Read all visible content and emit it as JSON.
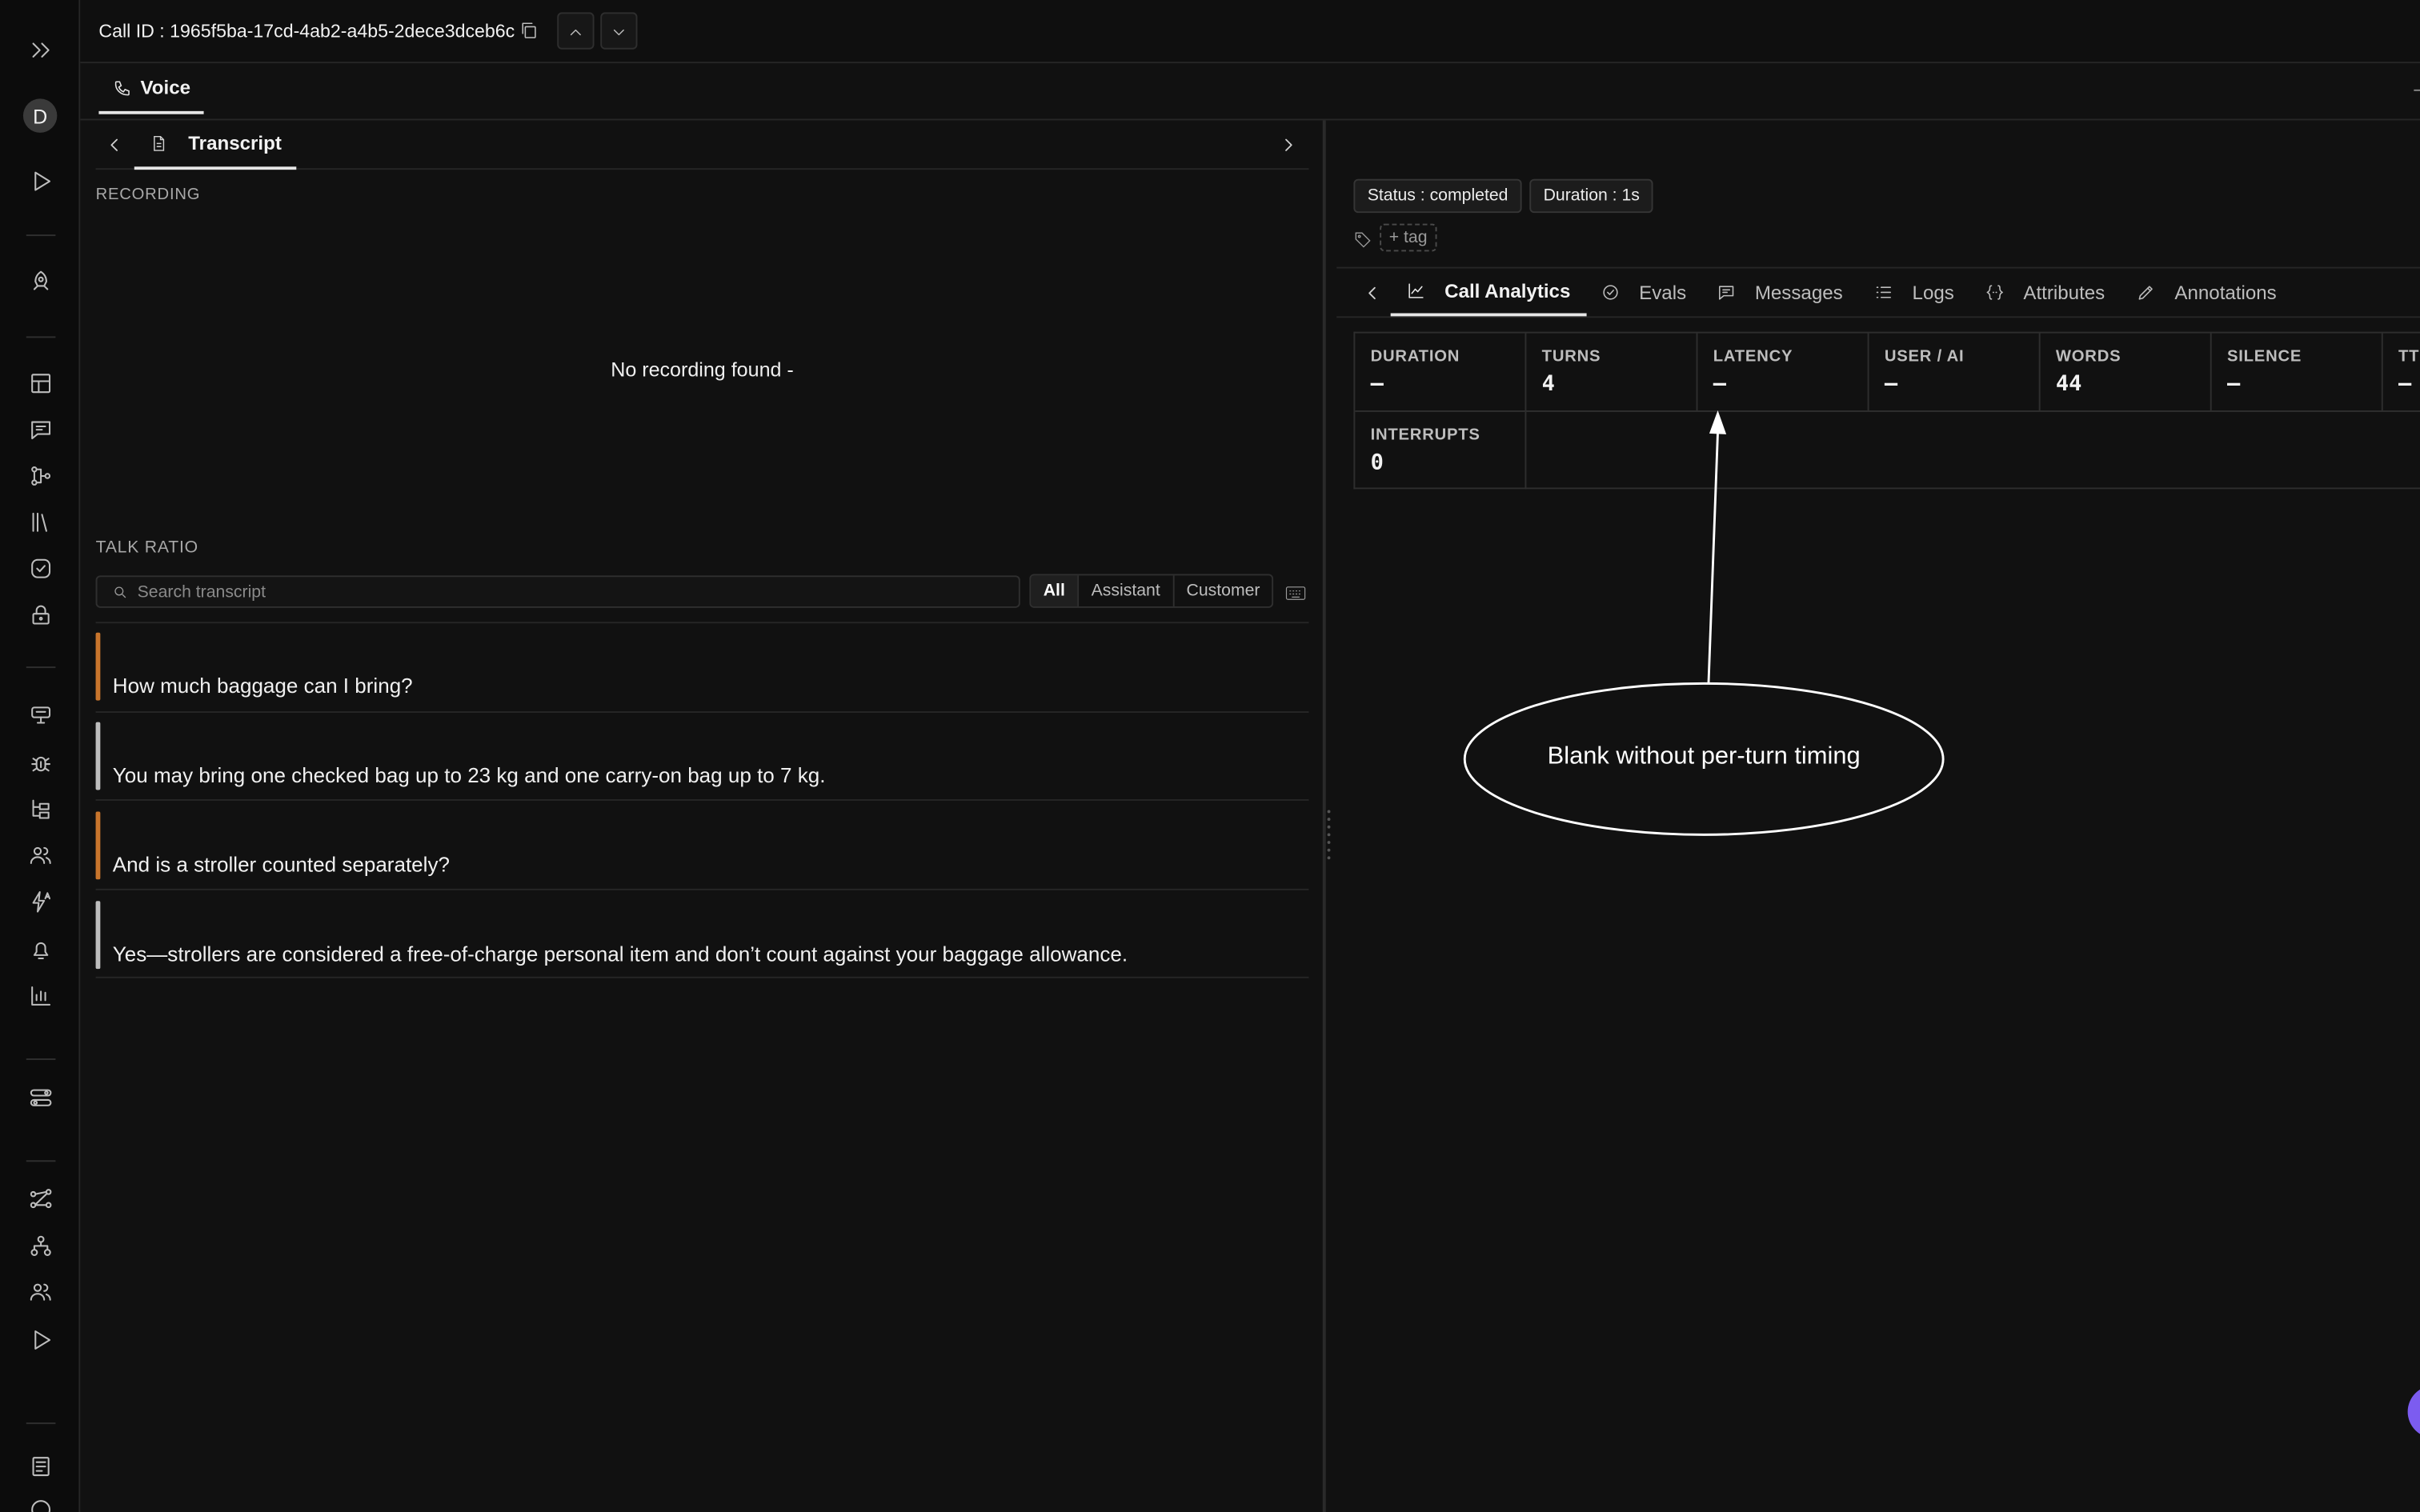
{
  "header": {
    "call_id": "Call ID : 1965f5ba-17cd-4ab2-a4b5-2dece3dceb6c",
    "avatar_letter": "D"
  },
  "tabs": {
    "voice": "Voice"
  },
  "left_panel": {
    "transcript_tab": "Transcript",
    "recording_label": "RECORDING",
    "no_recording": "No recording found -",
    "talk_ratio_label": "TALK RATIO",
    "search_placeholder": "Search transcript",
    "filters": [
      "All",
      "Assistant",
      "Customer"
    ],
    "messages": [
      {
        "role": "customer",
        "text": "How much baggage can I bring?"
      },
      {
        "role": "assistant",
        "text": "You may bring one checked bag up to 23 kg and one carry-on bag up to 7 kg."
      },
      {
        "role": "customer",
        "text": "And is a stroller counted separately?"
      },
      {
        "role": "assistant",
        "text": "Yes—strollers are considered a free-of-charge personal item and don’t count against your baggage allowance."
      }
    ]
  },
  "right_panel": {
    "status_chip": "Status : completed",
    "duration_chip": "Duration : 1s",
    "add_tag": "+ tag",
    "tabs": [
      "Call Analytics",
      "Evals",
      "Messages",
      "Logs",
      "Attributes",
      "Annotations"
    ],
    "metrics": [
      {
        "label": "DURATION",
        "value": "–"
      },
      {
        "label": "TURNS",
        "value": "4"
      },
      {
        "label": "LATENCY",
        "value": "–"
      },
      {
        "label": "USER / AI",
        "value": "–"
      },
      {
        "label": "WORDS",
        "value": "44"
      },
      {
        "label": "SILENCE",
        "value": "–"
      },
      {
        "label": "TTFB",
        "value": "–"
      },
      {
        "label": "INTERRUPTS",
        "value": "0"
      }
    ]
  },
  "annotation": {
    "text": "Blank without per-turn timing"
  },
  "colors": {
    "customer_bar": "#c8752c",
    "assistant_bar": "#bdbdbd",
    "fab": "#7c5cf0",
    "background": "#111111"
  }
}
